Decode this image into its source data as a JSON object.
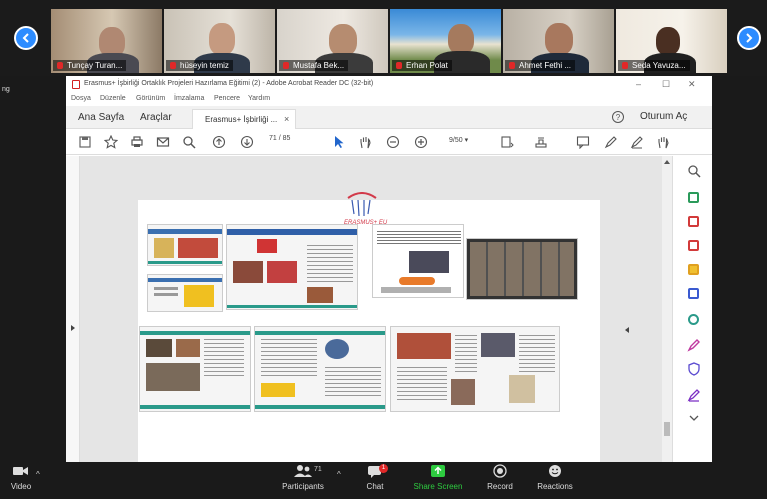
{
  "meeting": {
    "participants": [
      {
        "name": "Tunçay Turan..."
      },
      {
        "name": "hüseyin temiz"
      },
      {
        "name": "Mustafa Bek..."
      },
      {
        "name": "Erhan Polat"
      },
      {
        "name": "Ahmet Fethi ..."
      },
      {
        "name": "Seda Yavuza..."
      }
    ],
    "side_label": "ng",
    "controls": {
      "video": "Video",
      "participants": "Participants",
      "participant_count": "71",
      "chat": "Chat",
      "chat_badge": "1",
      "share": "Share Screen",
      "record": "Record",
      "reactions": "Reactions"
    },
    "colors": {
      "accent": "#2d8cff",
      "share": "#2ecc40",
      "muted": "#e02828"
    }
  },
  "reader": {
    "title": "Erasmus+ İşbirliği Ortaklık Projeleri Hazırlama Eğitimi (2) - Adobe Acrobat Reader DC (32-bit)",
    "menu": [
      "Dosya",
      "Düzenle",
      "Görünüm",
      "İmzalama",
      "Pencere",
      "Yardım"
    ],
    "tabs": {
      "home": "Ana Sayfa",
      "tools": "Araçlar",
      "doc": "Erasmus+ İşbirliği ...",
      "close": "×"
    },
    "help": "?",
    "sign_in": "Oturum Aç",
    "toolbar": {
      "page_current": "71",
      "page_total": "/ 85",
      "zoom": "9/50"
    },
    "page_logo": "ERASMUS+ EU"
  }
}
